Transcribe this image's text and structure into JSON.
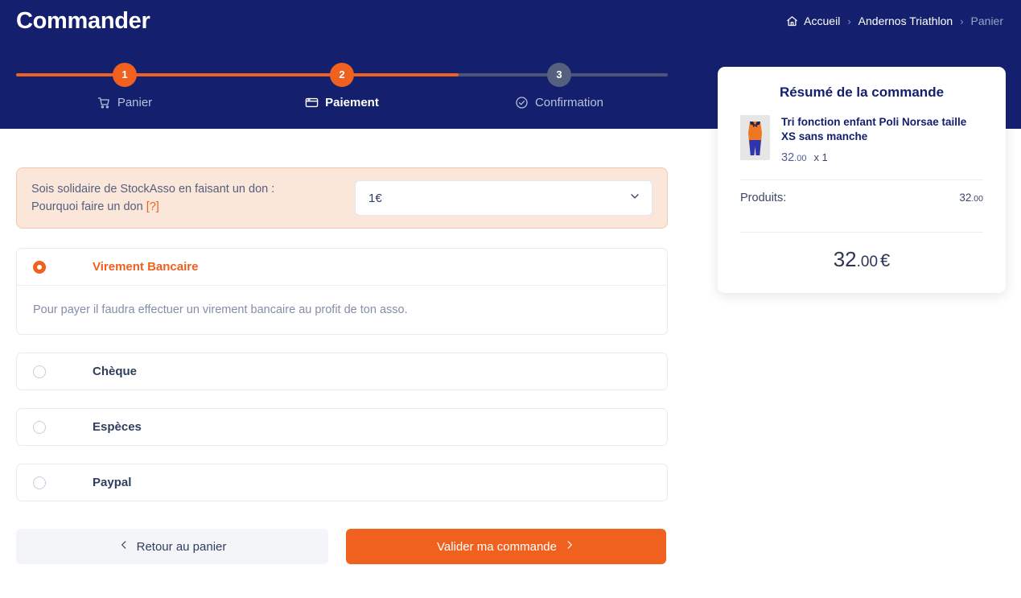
{
  "header": {
    "title": "Commander",
    "breadcrumb": [
      {
        "label": "Accueil",
        "icon": "home-icon",
        "current": false
      },
      {
        "label": "Andernos Triathlon",
        "icon": "",
        "current": false
      },
      {
        "label": "Panier",
        "icon": "",
        "current": true
      }
    ],
    "separator": "›"
  },
  "stepper": {
    "steps": [
      {
        "number": "1",
        "label": "Panier",
        "icon": "cart-icon",
        "state": "done"
      },
      {
        "number": "2",
        "label": "Paiement",
        "icon": "credit-card-icon",
        "state": "active"
      },
      {
        "number": "3",
        "label": "Confirmation",
        "icon": "check-circle-icon",
        "state": "todo"
      }
    ]
  },
  "donation": {
    "line1": "Sois solidaire de StockAsso en faisant un don :",
    "line2": "Pourquoi faire un don",
    "help_link": "[?]",
    "selected_amount": "1€",
    "options": [
      "1€"
    ]
  },
  "payment_methods": [
    {
      "label": "Virement Bancaire",
      "selected": true,
      "description": "Pour payer il faudra effectuer un virement bancaire au profit de ton asso."
    },
    {
      "label": "Chèque",
      "selected": false,
      "description": ""
    },
    {
      "label": "Espèces",
      "selected": false,
      "description": ""
    },
    {
      "label": "Paypal",
      "selected": false,
      "description": ""
    }
  ],
  "actions": {
    "back_label": "Retour au panier",
    "validate_label": "Valider ma commande"
  },
  "summary": {
    "title": "Résumé de la commande",
    "item": {
      "name": "Tri fonction enfant Poli Norsae taille XS sans manche",
      "price_int": "32",
      "price_dec": ".00",
      "quantity": "x 1"
    },
    "products_label": "Produits:",
    "products_int": "32",
    "products_dec": ".00",
    "total_int": "32",
    "total_dec": ".00",
    "currency": "€"
  },
  "colors": {
    "navy": "#14206e",
    "orange": "#f0601e",
    "peach_bg": "#fbe6da",
    "peach_border": "#f3c9ad",
    "muted_text": "#848da9",
    "track_gray": "#4a5578"
  }
}
